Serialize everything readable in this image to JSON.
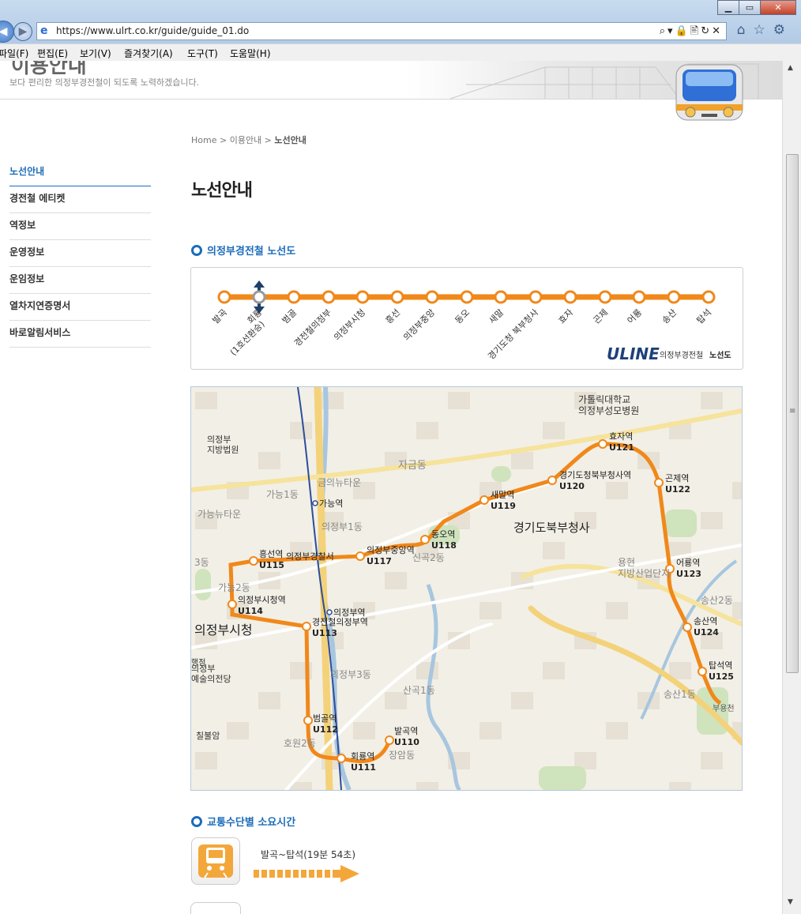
{
  "browser": {
    "url": "https://www.ulrt.co.kr/guide/guide_01.do",
    "menu": [
      "파일(F)",
      "편집(E)",
      "보기(V)",
      "즐겨찾기(A)",
      "도구(T)",
      "도움말(H)"
    ],
    "window_controls": [
      "▁",
      "▭",
      "✕"
    ],
    "address_tools": "⌕▾🔒🖹↻✕",
    "nav_icons": [
      "home-icon",
      "star-icon",
      "gear-icon"
    ]
  },
  "hero": {
    "title_partial": "이용안내",
    "subtitle": "보다 편리한 의정부경전철이 되도록 노력하겠습니다."
  },
  "breadcrumb": [
    "Home",
    "이용안내",
    "노선안내"
  ],
  "sidebar": {
    "items": [
      {
        "label": "노선안내",
        "active": true
      },
      {
        "label": "경전철 에티켓",
        "active": false
      },
      {
        "label": "역정보",
        "active": false
      },
      {
        "label": "운영정보",
        "active": false
      },
      {
        "label": "운임정보",
        "active": false
      },
      {
        "label": "열차지연증명서",
        "active": false
      },
      {
        "label": "바로알림서비스",
        "active": false
      }
    ]
  },
  "page_title": "노선안내",
  "route_section": {
    "heading": "의정부경전철 노선도",
    "stations": [
      "발곡",
      "회룡\n(1호선환승)",
      "범골",
      "경전철의정부",
      "의정부시청",
      "흥선",
      "의정부중앙",
      "동오",
      "새말",
      "경기도청 북부청사",
      "효자",
      "곤제",
      "어룡",
      "송산",
      "탑석"
    ],
    "transfer_index": 1,
    "logo_brand": "U LINE",
    "logo_text": "의정부경전철",
    "logo_text_bold": "노선도",
    "line_color": "#f0881a"
  },
  "map": {
    "stations": [
      {
        "name": "발곡역",
        "code": "U110"
      },
      {
        "name": "회룡역",
        "code": "U111"
      },
      {
        "name": "범골역",
        "code": "U112"
      },
      {
        "name": "경전철의정부역",
        "code": "U113"
      },
      {
        "name": "의정부시청역",
        "code": "U114"
      },
      {
        "name": "흥선역",
        "code": "U115"
      },
      {
        "name": "의정부중앙역",
        "code": "U117"
      },
      {
        "name": "동오역",
        "code": "U118"
      },
      {
        "name": "새말역",
        "code": "U119"
      },
      {
        "name": "경기도청북부청사역",
        "code": "U120"
      },
      {
        "name": "효자역",
        "code": "U121"
      },
      {
        "name": "곤제역",
        "code": "U122"
      },
      {
        "name": "어룡역",
        "code": "U123"
      },
      {
        "name": "송산역",
        "code": "U124"
      },
      {
        "name": "탑석역",
        "code": "U125"
      }
    ],
    "other_stations": [
      "가능역",
      "의정부역"
    ],
    "places": [
      "가톨릭대학교\n의정부성모병원",
      "의정부\n지방법원",
      "금의뉴타운",
      "자금동",
      "가능1동",
      "가능뉴타운",
      "의정부1동",
      "의정부경찰서",
      "신곡2동",
      "경기도북부청사",
      "용현\n지방산업단지",
      "송산2동",
      "가능2동",
      "의정부시청",
      "의정부\n예술의전당",
      "의정부3동",
      "산곡1동",
      "송산1동",
      "호원2동",
      "장암동",
      "칠불암",
      "3동",
      "행점",
      "부용천"
    ]
  },
  "time_section": {
    "heading": "교통수단별 소요시간",
    "route_label": "발곡~탑석(19분 54초)"
  }
}
